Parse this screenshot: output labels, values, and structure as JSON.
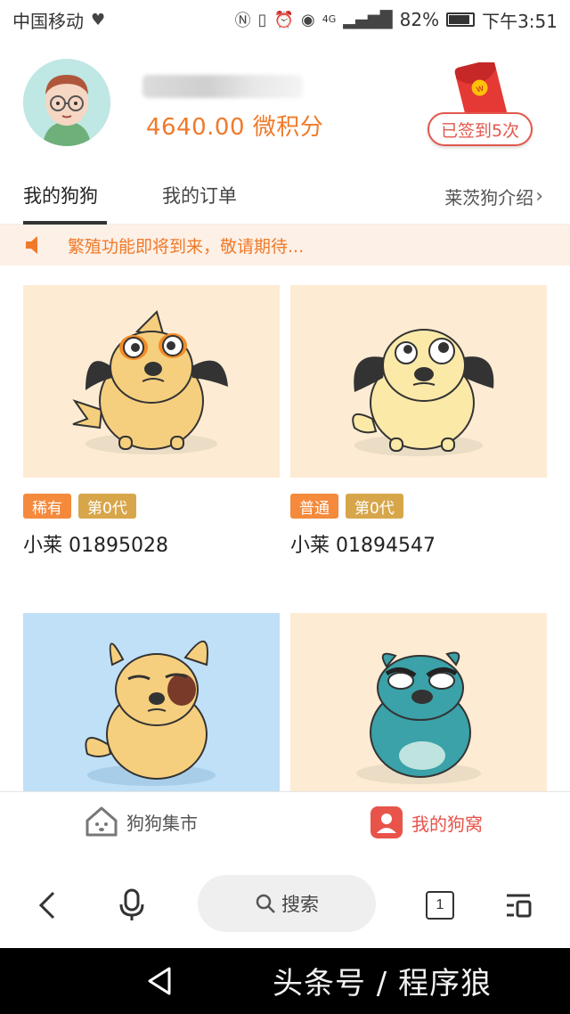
{
  "status_bar": {
    "carrier": "中国移动",
    "battery": "82%",
    "time": "下午3:51",
    "network": "4G"
  },
  "profile": {
    "points": "4640.00 微积分",
    "checkin_label": "已签到5次",
    "redpacket_mark": "w"
  },
  "tabs": {
    "my_dogs": "我的狗狗",
    "my_orders": "我的订单",
    "intro": "莱茨狗介绍"
  },
  "notice": {
    "text": "繁殖功能即将到来，敬请期待..."
  },
  "dogs": [
    {
      "rarity": "稀有",
      "generation": "第0代",
      "name": "小莱 01895028",
      "bg": "#fdebd3"
    },
    {
      "rarity": "普通",
      "generation": "第0代",
      "name": "小莱 01894547",
      "bg": "#fdebd3"
    },
    {
      "bg": "#bfe0f7"
    },
    {
      "bg": "#fdebd3"
    }
  ],
  "bottom_nav": {
    "market": "狗狗集市",
    "kennel": "我的狗窝"
  },
  "browser": {
    "search_label": "搜索",
    "tab_count": "1"
  },
  "watermark": "头条号 / 程序狼",
  "colors": {
    "accent_orange": "#f07a2a",
    "accent_red": "#e8534a",
    "notice_bg": "#fdf0e6"
  }
}
